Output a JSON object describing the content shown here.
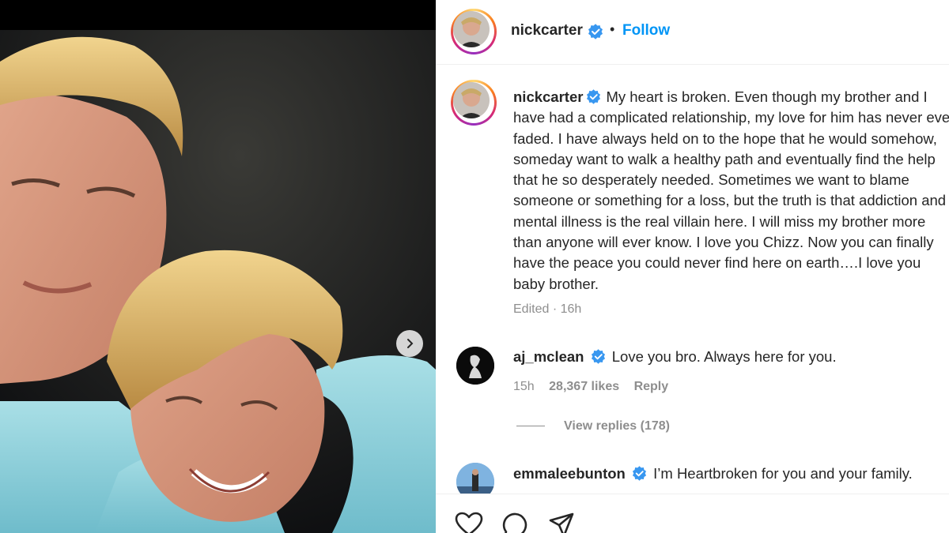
{
  "post": {
    "username": "nickcarter",
    "verified": true,
    "follow_label": "Follow",
    "separator": "•"
  },
  "caption": {
    "username": "nickcarter",
    "text": "My heart is broken. Even though my brother and I have had a complicated relationship, my love for him has never ever faded. I have always held on to the hope that he would somehow, someday want to walk a healthy path and eventually find the help that he so desperately needed. Sometimes we want to blame someone or something for a loss, but the truth is that addiction and mental illness is the real villain here. I will miss my brother more than anyone will ever know. I love you Chizz. Now you can finally have the peace you could never find here on earth….I love you baby brother.",
    "edited": "Edited · 16h"
  },
  "comments": [
    {
      "username": "aj_mclean",
      "text": "Love you bro. Always here for you.",
      "time": "15h",
      "likes": "28,367 likes",
      "reply_label": "Reply",
      "view_replies": "View replies (178)"
    },
    {
      "username": "emmaleebunton",
      "text": "I’m Heartbroken for you and your family."
    }
  ],
  "colors": {
    "accent": "#0095f6",
    "verified": "#3897f0",
    "muted": "#8e8e8e",
    "text": "#262626"
  },
  "icons": {
    "verified": "verified-badge-icon",
    "next": "chevron-right-icon",
    "like": "heart-icon",
    "comment": "comment-icon",
    "share": "paper-plane-icon"
  }
}
